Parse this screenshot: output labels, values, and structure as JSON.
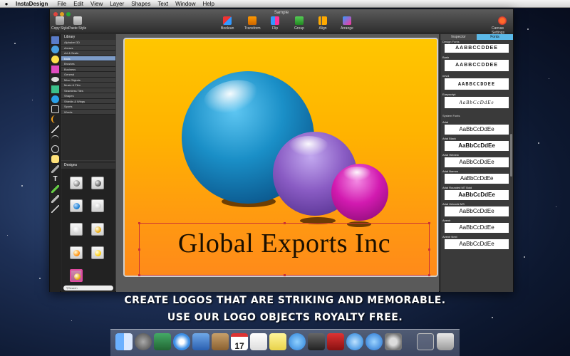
{
  "menubar": {
    "app_name": "InstaDesign",
    "items": [
      "File",
      "Edit",
      "View",
      "Layer",
      "Shapes",
      "Text",
      "Window",
      "Help"
    ]
  },
  "window": {
    "title": "Sample",
    "toolbar_left": [
      "Copy Style",
      "Paste Style"
    ],
    "toolbar_center": [
      "Boolean",
      "Transform",
      "Flip",
      "Group",
      "Align",
      "Arrange"
    ],
    "toolbar_right": "Canvas Settings"
  },
  "library": {
    "title": "Library",
    "items": [
      "Alphabet 3D",
      "Arrows",
      "Art & Seals",
      "Balls",
      "Brushes",
      "Business",
      "General",
      "Misc Objects",
      "Music & Film",
      "Seamless Tiles",
      "Shapes",
      "Shields & Wings",
      "Sports",
      "Words"
    ],
    "selected": "Balls"
  },
  "designs": {
    "title": "Designs",
    "search_placeholder": "Search"
  },
  "canvas": {
    "logo_text": "Global Exports Inc"
  },
  "right_panel": {
    "tabs": [
      "Inspector",
      "Fonts"
    ],
    "active_tab": "Fonts",
    "design_fonts_label": "Design Fonts",
    "design_fonts": [
      {
        "name": "",
        "preview": "AABBCCDDEE"
      },
      {
        "name": "Bash",
        "preview": "AABBCCDDEE"
      },
      {
        "name": "new1",
        "preview": "AABBCCDDEE"
      },
      {
        "name": "Easyscript",
        "preview": "AaBbCcDdEe"
      }
    ],
    "system_fonts_label": "System Fonts",
    "system_fonts": [
      {
        "name": "Arial",
        "preview": "AaBbCcDdEe"
      },
      {
        "name": "Arial Black",
        "preview": "AaBbCcDdEe"
      },
      {
        "name": "Arial Hebrew",
        "preview": "AaBbCcDdEe"
      },
      {
        "name": "Arial Narrow",
        "preview": "AaBbCcDdEe"
      },
      {
        "name": "Arial Rounded MT Bold",
        "preview": "AaBbCcDdEe"
      },
      {
        "name": "Arial Unicode MS",
        "preview": "AaBbCcDdEe"
      },
      {
        "name": "Avenir",
        "preview": "AaBbCcDdEe"
      },
      {
        "name": "Avenir Next",
        "preview": "AaBbCcDdEe"
      }
    ]
  },
  "promo": {
    "line1": "CREATE LOGOS THAT ARE STRIKING AND MEMORABLE.",
    "line2": "USE OUR LOGO OBJECTS ROYALTY FREE."
  },
  "dock": {
    "calendar_day": "17",
    "items": [
      "finder-icon",
      "launchpad-icon",
      "mission-control-icon",
      "safari-icon",
      "mail-icon",
      "contacts-icon",
      "calendar-icon",
      "reminders-icon",
      "notes-icon",
      "messages-icon",
      "facetime-icon",
      "photo-booth-icon",
      "itunes-icon",
      "app-store-icon",
      "system-preferences-icon",
      "downloads-stack-icon",
      "trash-icon"
    ]
  },
  "colors": {
    "accent_tab": "#5bb9e8",
    "canvas_top": "#ffc600",
    "canvas_bottom": "#ff8a1a",
    "library_selected": "#7d9cc8",
    "ball_blue": "#1a8fc7",
    "ball_purple": "#8a5cc4",
    "ball_magenta": "#d21ab0"
  }
}
